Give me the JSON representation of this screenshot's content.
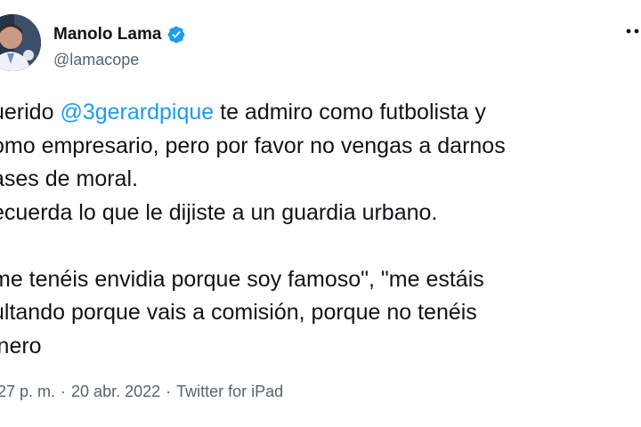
{
  "author": {
    "name": "Manolo Lama",
    "handle": "@lamacope",
    "verified": true,
    "avatar_icon": "profile-photo"
  },
  "tweet": {
    "line1_pre": "uerido ",
    "mention": "@3gerardpique",
    "line1_post": "  te admiro como futbolista y",
    "line2": "omo empresario, pero por favor no vengas a darnos",
    "line3": "ases de moral.",
    "line4": "ecuerda lo que le dijiste a un guardia urbano.",
    "line5": "me tenéis envidia porque soy famoso\", \"me estáis",
    "line6": "ultando porque vais a comisión, porque no tenéis",
    "line7": "inero"
  },
  "meta": {
    "time": "27 p. m.",
    "sep1": "·",
    "date": "20 abr. 2022",
    "sep2": "·",
    "source": "Twitter for iPad"
  },
  "colors": {
    "mention": "#1d9bf0",
    "verified": "#1d9bf0",
    "secondary_text": "#536471"
  }
}
